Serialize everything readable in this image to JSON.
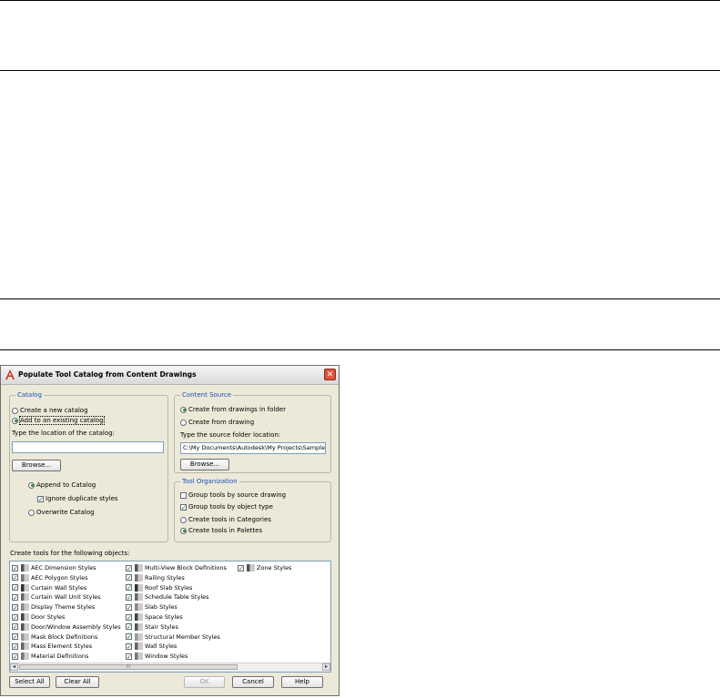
{
  "dialog": {
    "title": "Populate Tool Catalog from Content Drawings",
    "close_glyph": "✕",
    "catalog": {
      "legend": "Catalog",
      "create_new": "Create a new catalog",
      "add_existing": "Add to an existing catalog",
      "location_label": "Type the location of the catalog:",
      "location_value": "",
      "browse": "Browse...",
      "append": "Append to Catalog",
      "ignore_dup": "Ignore duplicate styles",
      "overwrite": "Overwrite Catalog"
    },
    "content_source": {
      "legend": "Content Source",
      "from_folder": "Create from drawings in folder",
      "from_drawing": "Create from drawing",
      "folder_label": "Type the source folder location:",
      "folder_value": "C:\\My Documents\\Autodesk\\My Projects\\Sample I",
      "browse": "Browse..."
    },
    "tool_org": {
      "legend": "Tool Organization",
      "group_source": "Group tools by source drawing",
      "group_type": "Group tools by object type",
      "in_categories": "Create tools in Categories",
      "in_palettes": "Create tools in Palettes"
    },
    "objects_label": "Create tools for the following objects:",
    "objects": {
      "col1": [
        "AEC Dimension Styles",
        "AEC Polygon Styles",
        "Curtain Wall Styles",
        "Curtain Wall Unit Styles",
        "Display Theme Styles",
        "Door Styles",
        "Door/Window Assembly Styles",
        "Mask Block Definitions",
        "Mass Element Styles",
        "Material Definitions"
      ],
      "col2": [
        "Multi-View Block Definitions",
        "Railing Styles",
        "Roof Slab Styles",
        "Schedule Table Styles",
        "Slab Styles",
        "Space Styles",
        "Stair Styles",
        "Structural Member Styles",
        "Wall Styles",
        "Window Styles"
      ],
      "col3": [
        "Zone Styles"
      ]
    },
    "scroll": {
      "left": "◂",
      "right": "▸",
      "grip": "III"
    },
    "buttons": {
      "select_all": "Select All",
      "clear_all": "Clear All",
      "ok": "OK",
      "cancel": "Cancel",
      "help": "Help"
    },
    "check_glyph": "✓"
  }
}
